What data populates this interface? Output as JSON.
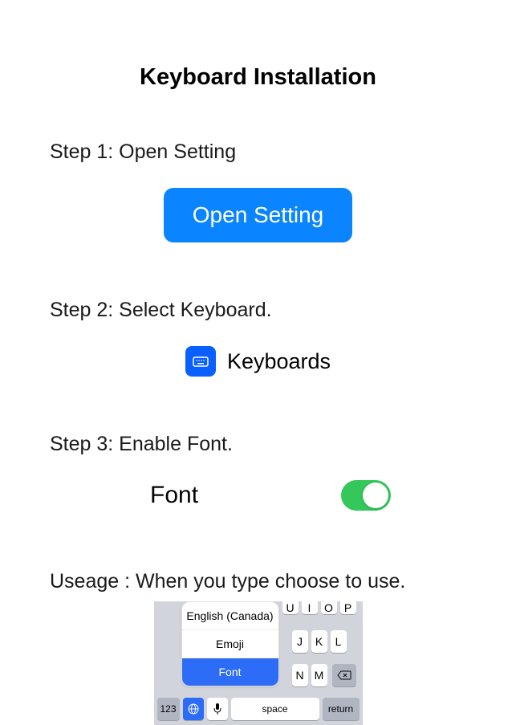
{
  "title": "Keyboard Installation",
  "step1": {
    "label": "Step 1: Open Setting",
    "button": "Open Setting"
  },
  "step2": {
    "label": "Step 2: Select Keyboard.",
    "item": "Keyboards"
  },
  "step3": {
    "label": "Step 3: Enable Font.",
    "item": "Font",
    "enabled": true
  },
  "usage": {
    "label": "Useage : When you type choose to use.",
    "keyboard": {
      "popup_options": [
        "English (Canada)",
        "Emoji",
        "Font"
      ],
      "top_row_partial": [
        "U",
        "I",
        "O",
        "P"
      ],
      "mid_row_right": [
        "J",
        "K",
        "L"
      ],
      "bot_row_right": [
        "N",
        "M"
      ],
      "num_key": "123",
      "space_key": "space",
      "return_key": "return"
    }
  }
}
